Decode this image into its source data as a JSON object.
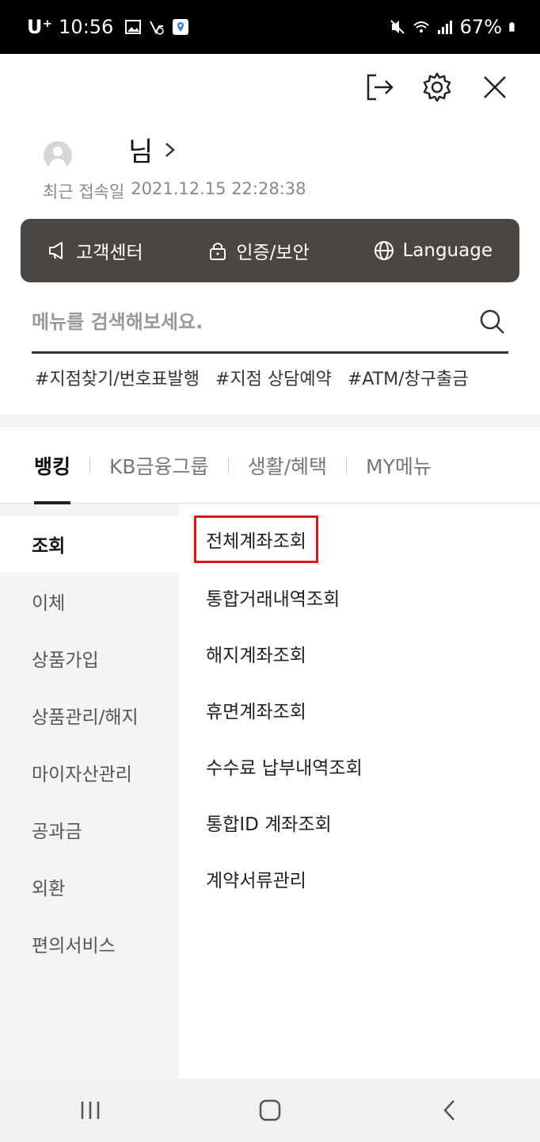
{
  "status_bar": {
    "carrier": "U⁺",
    "time": "10:56",
    "battery": "67%"
  },
  "header": {
    "user_suffix": "님",
    "last_login_label": "최근 접속일",
    "last_login_value": "2021.12.15 22:28:38"
  },
  "quick_links": [
    {
      "label": "고객센터",
      "icon": "megaphone-icon"
    },
    {
      "label": "인증/보안",
      "icon": "lock-icon"
    },
    {
      "label": "Language",
      "icon": "globe-icon"
    }
  ],
  "search": {
    "placeholder": "메뉴를 검색해보세요."
  },
  "hashtags": [
    "#지점찾기/번호표발행",
    "#지점 상담예약",
    "#ATM/창구출금"
  ],
  "tabs": [
    {
      "label": "뱅킹",
      "active": true
    },
    {
      "label": "KB금융그룹",
      "active": false
    },
    {
      "label": "생활/혜택",
      "active": false
    },
    {
      "label": "MY메뉴",
      "active": false
    }
  ],
  "left_menu": [
    {
      "label": "조회",
      "active": true
    },
    {
      "label": "이체"
    },
    {
      "label": "상품가입"
    },
    {
      "label": "상품관리/해지"
    },
    {
      "label": "마이자산관리"
    },
    {
      "label": "공과금"
    },
    {
      "label": "외환"
    },
    {
      "label": "편의서비스"
    }
  ],
  "submenu": [
    {
      "label": "전체계좌조회",
      "highlighted": true
    },
    {
      "label": "통합거래내역조회"
    },
    {
      "label": "해지계좌조회"
    },
    {
      "label": "휴면계좌조회"
    },
    {
      "label": "수수료 납부내역조회"
    },
    {
      "label": "통합ID 계좌조회"
    },
    {
      "label": "계약서류관리"
    }
  ],
  "colors": {
    "quickbar_bg": "#4a4644",
    "highlight": "#e0141e",
    "nav_bg": "#f1f1f1"
  }
}
